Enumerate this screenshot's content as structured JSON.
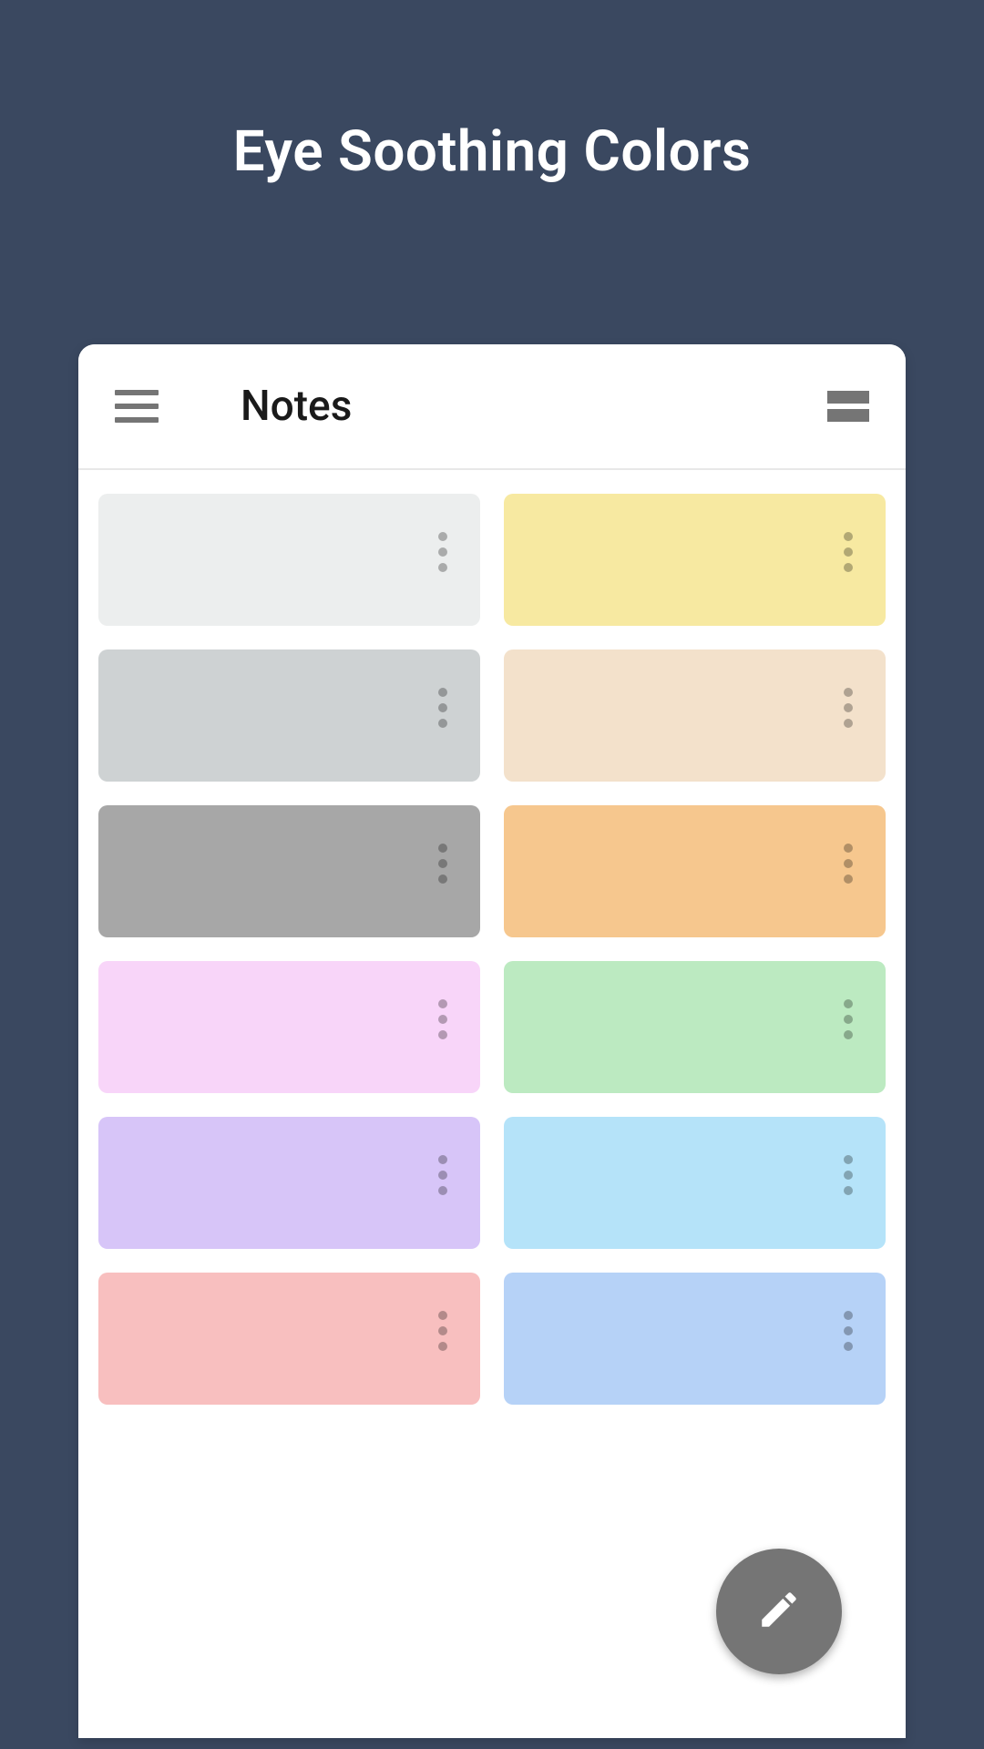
{
  "page": {
    "title": "Eye Soothing Colors"
  },
  "app": {
    "title": "Notes"
  },
  "notes": [
    {
      "color": "#eceeee"
    },
    {
      "color": "#f7e9a1"
    },
    {
      "color": "#ced2d3"
    },
    {
      "color": "#f3e1cb"
    },
    {
      "color": "#a7a7a7"
    },
    {
      "color": "#f6c78e"
    },
    {
      "color": "#f8d5f9"
    },
    {
      "color": "#bceac1"
    },
    {
      "color": "#d7c5f8"
    },
    {
      "color": "#b5e3f9"
    },
    {
      "color": "#f8bfbf"
    },
    {
      "color": "#b6d2f7"
    }
  ]
}
